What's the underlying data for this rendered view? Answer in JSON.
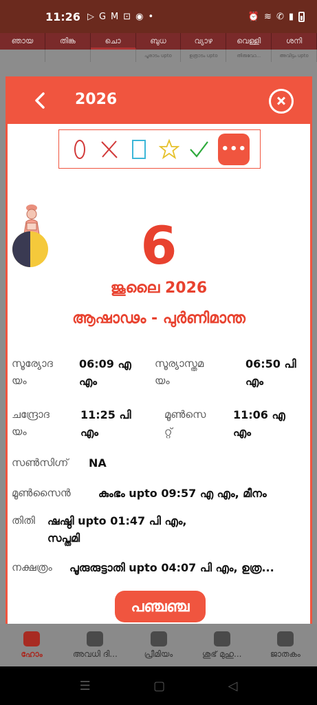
{
  "status_bar": {
    "time": "11:26",
    "app_icons": [
      "play-icon",
      "g-icon",
      "gmail-icon",
      "cast-icon",
      "messenger-icon",
      "dot-icon"
    ],
    "system_icons": [
      "alarm-icon",
      "wifi-icon",
      "wifi-call-icon",
      "signal-icon",
      "battery-icon"
    ]
  },
  "background_calendar": {
    "days": [
      "ഞായ",
      "തിങ്ക",
      "ചൊ",
      "ബുധ",
      "വ്യാഴ",
      "വെള്ളി",
      "ശനി"
    ],
    "sub": [
      "",
      "",
      "",
      "പൂരാടം upto",
      "ഉത്രാടം upto",
      "തിരുവോ...",
      "അവിട്ടം upto"
    ]
  },
  "dialog": {
    "year": "2026",
    "marks": [
      "circle-mark",
      "cross-mark",
      "square-mark",
      "star-mark",
      "check-mark"
    ],
    "more_label": "•••",
    "date": "6",
    "month_year": "ജൂലൈ 2026",
    "masam": "ആഷാഢം - പുർണിമാന്ത",
    "sunrise_label_1": "സൂര്യോദ",
    "sunrise_label_2": "യം",
    "sunrise_value_1": "06:09 എ",
    "sunrise_value_2": "എം",
    "sunset_label_1": "സൂര്യാസ്തമ",
    "sunset_label_2": "യം",
    "sunset_value_1": "06:50 പി",
    "sunset_value_2": "എം",
    "moonrise_label_1": "ചന്ദ്രോദ",
    "moonrise_label_2": "യം",
    "moonrise_value_1": "11:25 പി",
    "moonrise_value_2": "എം",
    "moonset_label_1": "മൂൺസെ",
    "moonset_label_2": "റ്റ്",
    "moonset_value_1": "11:06 എ",
    "moonset_value_2": "എം",
    "sunsign_label": "സൺസിഗ്ന്",
    "sunsign_value": "NA",
    "moonsign_label": "മൂൺസൈൻ",
    "moonsign_value": "കുംഭം upto 09:57 എ എം, മീനം",
    "tithi_label": "തിതി",
    "tithi_value_1": "ഷഷ്ഠി upto 01:47 പി എം,",
    "tithi_value_2": "സപ്തമി",
    "nakshatra_label": "നക്ഷത്രം",
    "nakshatra_value": "പൂരുരുട്ടാതി upto 04:07 പി എം, ഉത്ര...",
    "panchang_button": "പഞ്ചഞ്ച"
  },
  "bottom_nav": [
    {
      "label": "ഹോം",
      "icon": "home-icon",
      "active": true
    },
    {
      "label": "അവധി ദി...",
      "icon": "holiday-icon",
      "active": false
    },
    {
      "label": "പ്രീമിയം",
      "icon": "premium-icon",
      "active": false
    },
    {
      "label": "ശുഭ് മുഹു...",
      "icon": "muhurat-icon",
      "active": false
    },
    {
      "label": "ജാതകം",
      "icon": "horoscope-icon",
      "active": false
    }
  ],
  "colors": {
    "accent": "#f0553f",
    "date_red": "#e8422f",
    "check_green": "#2eaa3c",
    "star_yellow": "#e6c12b",
    "square_cyan": "#3cb7d8"
  }
}
